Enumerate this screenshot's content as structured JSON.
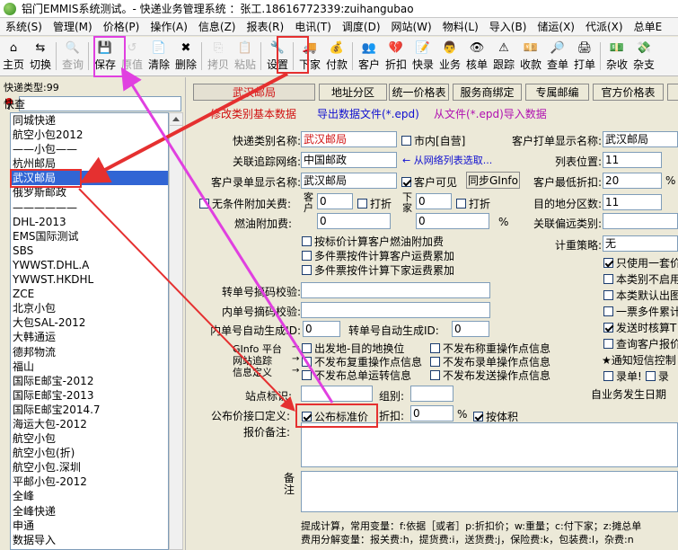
{
  "window": {
    "title": "铝门EMMIS系统测试。- 快递业务管理系统 ：张工.18616772339:zuihangubao"
  },
  "menu": [
    "系统(S)",
    "管理(M)",
    "价格(P)",
    "操作(A)",
    "信息(Z)",
    "报表(R)",
    "电讯(T)",
    "调度(D)",
    "网站(W)",
    "物料(L)",
    "导入(B)",
    "储运(X)",
    "代派(X)",
    "总单E"
  ],
  "toolbar": [
    {
      "label": "主页",
      "icon": "⌂",
      "disabled": false
    },
    {
      "label": "切换",
      "icon": "⇆",
      "disabled": false
    },
    {
      "label": "查询",
      "icon": "🔍",
      "disabled": true
    },
    {
      "label": "保存",
      "icon": "💾",
      "disabled": false
    },
    {
      "label": "原值",
      "icon": "↺",
      "disabled": true
    },
    {
      "label": "清除",
      "icon": "📄",
      "disabled": false
    },
    {
      "label": "删除",
      "icon": "✖",
      "disabled": false
    },
    {
      "label": "拷贝",
      "icon": "⎘",
      "disabled": true
    },
    {
      "label": "粘贴",
      "icon": "📋",
      "disabled": true
    },
    {
      "label": "设置",
      "icon": "🔧",
      "disabled": false
    },
    {
      "label": "下家",
      "icon": "🚚",
      "disabled": false
    },
    {
      "label": "付款",
      "icon": "💰",
      "disabled": false
    },
    {
      "label": "客户",
      "icon": "👥",
      "disabled": false
    },
    {
      "label": "折扣",
      "icon": "💔",
      "disabled": false
    },
    {
      "label": "快录",
      "icon": "📝",
      "disabled": false
    },
    {
      "label": "业务",
      "icon": "👨",
      "disabled": false
    },
    {
      "label": "核单",
      "icon": "👁",
      "disabled": false
    },
    {
      "label": "跟踪",
      "icon": "⚠",
      "disabled": false
    },
    {
      "label": "收款",
      "icon": "💴",
      "disabled": false
    },
    {
      "label": "查单",
      "icon": "🔎",
      "disabled": false
    },
    {
      "label": "打单",
      "icon": "🖨",
      "disabled": false
    },
    {
      "label": "杂收",
      "icon": "💵",
      "disabled": false
    },
    {
      "label": "杂支",
      "icon": "💸",
      "disabled": false
    }
  ],
  "left": {
    "type_label": "快递类型:99",
    "search_label": "快查",
    "search_value": "",
    "items": [
      "同城快递",
      "航空小包2012",
      "——小包——",
      "杭州邮局",
      "武汉邮局",
      "俄罗斯邮政",
      "——————",
      "DHL-2013",
      "EMS国际测试",
      "SBS",
      "YWWST.DHL.A",
      "YWWST.HKDHL",
      "ZCE",
      "北京小包",
      "大包SAL-2012",
      "大韩通运",
      "德邦物流",
      "福山",
      "国际E邮宝-2012",
      "国际E邮宝-2013",
      "国际E邮宝2014.7",
      "海运大包-2012",
      "航空小包",
      "航空小包(折)",
      "航空小包.深圳",
      "平邮小包-2012",
      "全峰",
      "全峰快递",
      "申通",
      "数据导入"
    ],
    "selected_index": 4
  },
  "tabs": [
    "武汉邮局",
    "地址分区",
    "统一价格表",
    "服务商绑定",
    "专属邮编",
    "官方价格表"
  ],
  "links": {
    "edit": "修改类别基本数据",
    "export": "导出数据文件(*.epd)",
    "import": "从文件(*.epd)导入数据"
  },
  "form": {
    "type_name_label": "快递类别名称:",
    "type_name_value": "武汉邮局",
    "local_label": "市内[自营]",
    "client_print_label": "客户打单显示名称:",
    "client_print_value": "武汉邮局",
    "tracking_label": "关联追踪网络:",
    "tracking_value": "中国邮政",
    "select_hint": "← 从网络列表选取...",
    "list_pos_label": "列表位置:",
    "list_pos_value": "11",
    "record_label": "客户录单显示名称:",
    "record_value": "武汉邮局",
    "client_visible_label": "客户可见",
    "sync_button": "同步GInfo",
    "min_discount_label": "客户最低折扣:",
    "min_discount_value": "20",
    "pct": "%",
    "cond_fee_label": "无条件附加关费:",
    "client_v": "客户",
    "fee1": "0",
    "discount_label": "打折",
    "lower_v": "下家",
    "fee2": "0",
    "dest_zone_label": "目的地分区数:",
    "dest_zone_value": "11",
    "fuel_label": "燃油附加费:",
    "fuel1": "0",
    "fuel2": "0",
    "rel_remote_label": "关联偏远类别:",
    "opt1": "按标价计算客户燃油附加费",
    "opt2": "多件票按件计算客户运费累加",
    "opt3": "多件票按件计算下家运费累加",
    "meter_label": "计重策略:",
    "meter_value": "无",
    "r1": "只使用一套价",
    "r2": "本类别不启用",
    "r3": "本类默认出图",
    "r4": "一票多件累计",
    "r5": "发送时核算T",
    "r6": "查询客户报价",
    "r7": "★通知短信控制",
    "r8": "录单!",
    "r9": "录",
    "trans_label": "转单号摘码校验:",
    "inner_label": "内单号摘码校验:",
    "autogen_label": "内单号自动生成ID:",
    "autogen_value": "0",
    "trans_autogen_label": "转单号自动生成ID:",
    "trans_autogen_value": "0",
    "ginfo_left": "GInfo 平台",
    "ginfo_mid": "网站追踪",
    "ginfo_right": "信息定义",
    "g1": "出发地-目的地换位",
    "g2": "不发布称重操作点信息",
    "g3": "不发布复重操作点信息",
    "g4": "不发布录单操作点信息",
    "g5": "不发布总单运转信息",
    "g6": "不发布发送操作点信息",
    "station_label": "站点标识:",
    "group_label": "组别:",
    "biz_date_label": "自业务发生日期",
    "price_def_label": "公布价接口定义:",
    "publish_label": "公布标准价",
    "discount2_label": "折扣:",
    "discount2_value": "0",
    "volume_label": "按体积",
    "remark_label": "报价备注:",
    "note_label": "备注",
    "formula1": "提成计算，常用变量：f:依据［或者］p:折扣价；w:重量；c:付下家；z:摊总单",
    "formula2": "费用分解变量：报关费:h，提货费:i，送货费:j，保险费:k，包装费:l，杂费:n"
  }
}
